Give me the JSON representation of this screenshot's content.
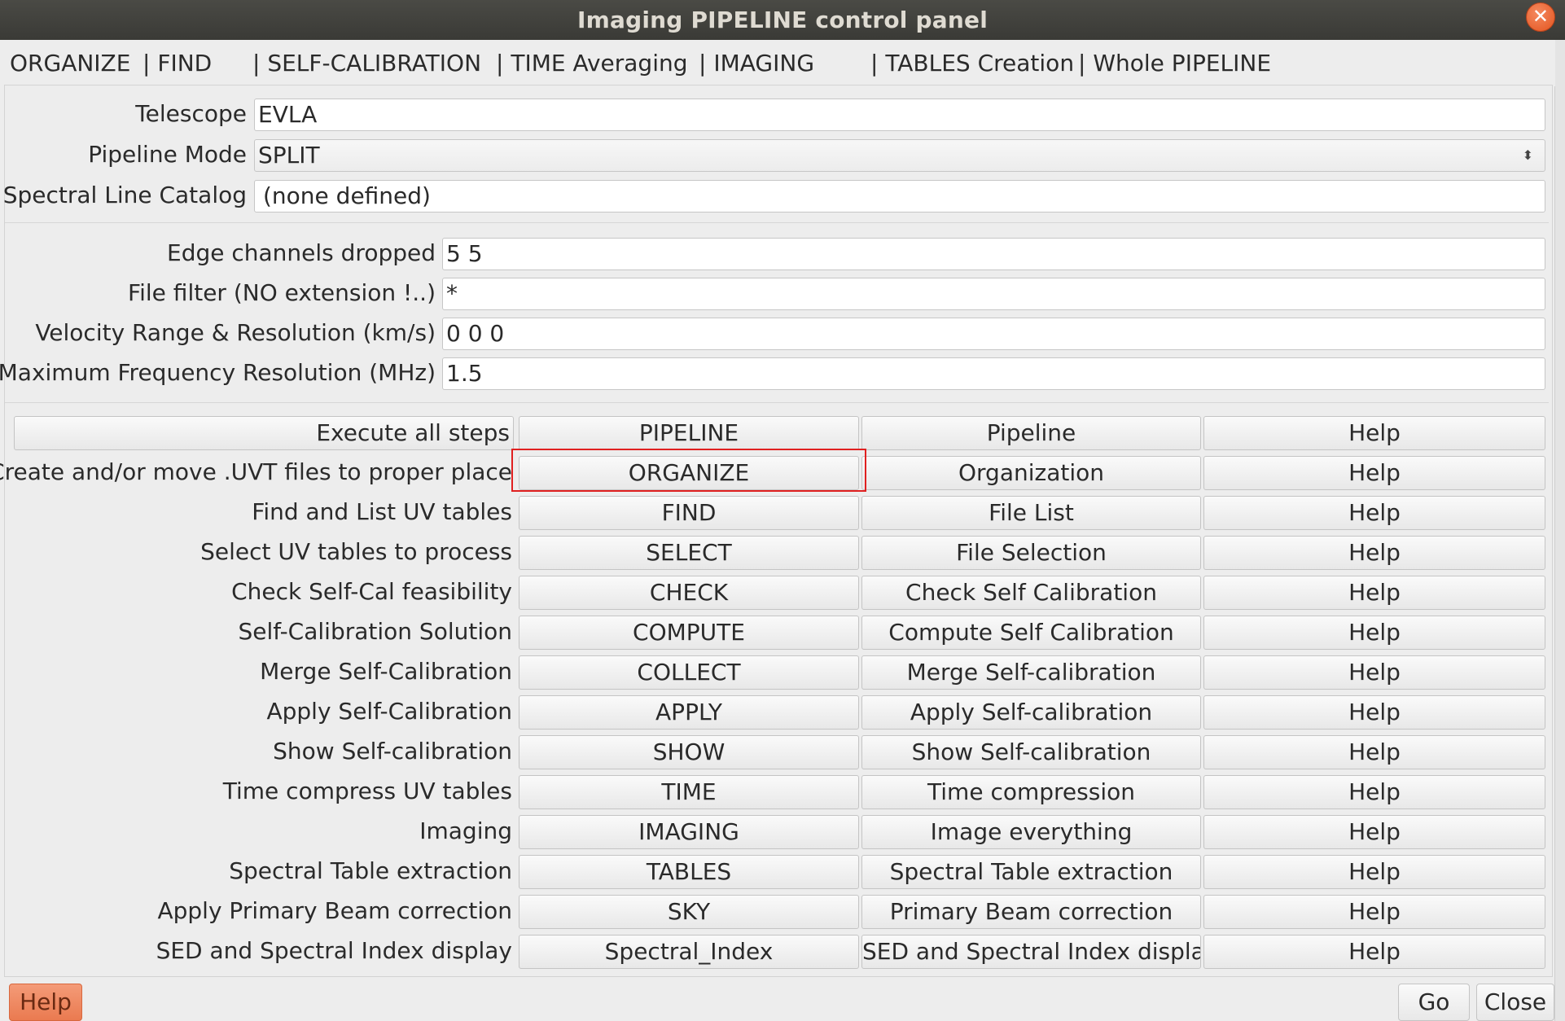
{
  "window": {
    "title": "Imaging PIPELINE control panel",
    "close_symbol": "✕"
  },
  "menu": [
    {
      "label": "ORGANIZE"
    },
    {
      "label": "| FIND"
    },
    {
      "label": "| SELF-CALIBRATION"
    },
    {
      "label": "| TIME Averaging"
    },
    {
      "label": "| IMAGING"
    },
    {
      "label": "| TABLES Creation"
    },
    {
      "label": "| Whole PIPELINE"
    }
  ],
  "settings": {
    "telescope": {
      "label": "Telescope",
      "value": "EVLA"
    },
    "pipeline_mode": {
      "label": "Pipeline Mode",
      "value": "SPLIT"
    },
    "spectral_line_catalog": {
      "label": "Spectral Line Catalog",
      "value": "(none defined)"
    }
  },
  "params": {
    "edge_channels": {
      "label": "Edge channels dropped",
      "value": "5 5"
    },
    "file_filter": {
      "label": "File filter (NO extension !..)",
      "value": "*"
    },
    "velocity_range": {
      "label": "Velocity Range & Resolution (km/s)",
      "value": "0 0 0"
    },
    "max_freq_res": {
      "label": "Maximum Frequency Resolution (MHz)",
      "value": "1.5"
    }
  },
  "steps": [
    {
      "description": "Execute all steps",
      "action": "PIPELINE",
      "panel": "Pipeline",
      "help": "Help"
    },
    {
      "description": "Create and/or move .UVT files to proper place",
      "action": "ORGANIZE",
      "panel": "Organization",
      "help": "Help"
    },
    {
      "description": "Find and List UV tables",
      "action": "FIND",
      "panel": "File List",
      "help": "Help"
    },
    {
      "description": "Select UV tables to process",
      "action": "SELECT",
      "panel": "File Selection",
      "help": "Help"
    },
    {
      "description": "Check Self-Cal feasibility",
      "action": "CHECK",
      "panel": "Check Self Calibration",
      "help": "Help"
    },
    {
      "description": "Self-Calibration Solution",
      "action": "COMPUTE",
      "panel": "Compute Self Calibration",
      "help": "Help"
    },
    {
      "description": "Merge Self-Calibration",
      "action": "COLLECT",
      "panel": "Merge Self-calibration",
      "help": "Help"
    },
    {
      "description": "Apply Self-Calibration",
      "action": "APPLY",
      "panel": "Apply Self-calibration",
      "help": "Help"
    },
    {
      "description": "Show Self-calibration",
      "action": "SHOW",
      "panel": "Show Self-calibration",
      "help": "Help"
    },
    {
      "description": "Time compress UV tables",
      "action": "TIME",
      "panel": "Time compression",
      "help": "Help"
    },
    {
      "description": "Imaging",
      "action": "IMAGING",
      "panel": "Image everything",
      "help": "Help"
    },
    {
      "description": "Spectral Table extraction",
      "action": "TABLES",
      "panel": "Spectral Table extraction",
      "help": "Help"
    },
    {
      "description": "Apply Primary Beam correction",
      "action": "SKY",
      "panel": "Primary Beam correction",
      "help": "Help"
    },
    {
      "description": "SED and Spectral Index display",
      "action": "Spectral_Index",
      "panel": "SED and Spectral Index display",
      "help": "Help"
    }
  ],
  "footer": {
    "help_label": "Help",
    "go_label": "Go",
    "close_label": "Close"
  },
  "colors": {
    "titlebar": "#3f3f3b",
    "close_button": "#e3541f",
    "highlight": "#e02020",
    "help_button": "#ea7a50"
  }
}
